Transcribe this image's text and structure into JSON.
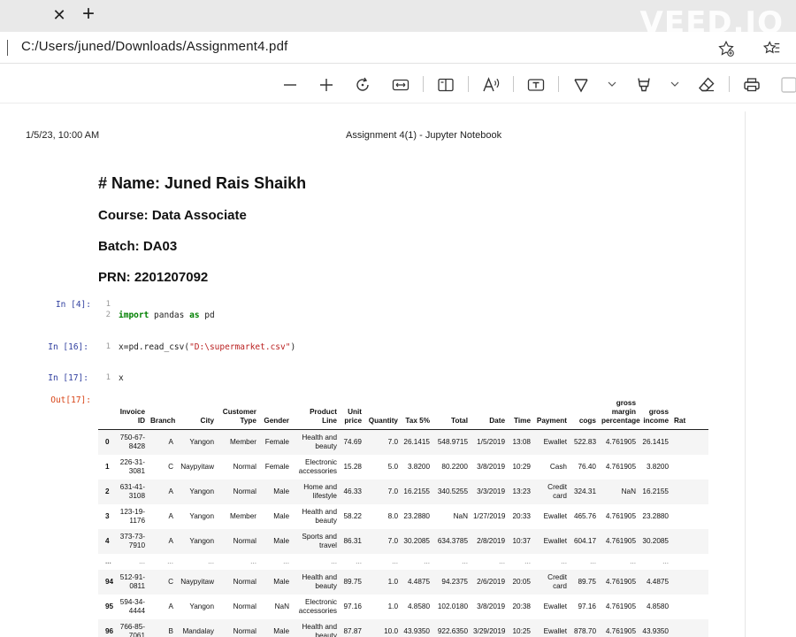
{
  "browser": {
    "close_glyph": "✕",
    "new_tab_glyph": "+",
    "watermark": "VEED.IO",
    "address": "C:/Users/juned/Downloads/Assignment4.pdf"
  },
  "toolbar": {
    "icons": [
      "zoom-out-icon",
      "zoom-in-icon",
      "rotate-icon",
      "fit-width-icon",
      "page-view-icon",
      "read-aloud-icon",
      "text-box-icon",
      "draw-icon",
      "highlight-icon",
      "eraser-icon",
      "print-icon",
      "save-icon"
    ]
  },
  "print_header": {
    "date": "1/5/23, 10:00 AM",
    "title": "Assignment 4(1) - Jupyter Notebook"
  },
  "notebook": {
    "name_heading": "# Name: Juned Rais Shaikh",
    "course": "Course: Data Associate",
    "batch": "Batch: DA03",
    "prn": "PRN: 2201207092",
    "cells": [
      {
        "prompt": "In [4]:",
        "lines": [
          "",
          "import pandas as pd"
        ]
      },
      {
        "prompt": "In [16]:",
        "lines": [
          "x=pd.read_csv(\"D:\\supermarket.csv\")"
        ]
      },
      {
        "prompt": "In [17]:",
        "lines": [
          "x"
        ]
      }
    ],
    "out_prompt": "Out[17]:"
  },
  "dataframe": {
    "columns": [
      "",
      "Invoice ID",
      "Branch",
      "City",
      "Customer Type",
      "Gender",
      "Product Line",
      "Unit price",
      "Quantity",
      "Tax 5%",
      "Total",
      "Date",
      "Time",
      "Payment",
      "cogs",
      "gross margin percentage",
      "gross income",
      "Rat"
    ],
    "rows": [
      [
        "0",
        "750-67-8428",
        "A",
        "Yangon",
        "Member",
        "Female",
        "Health and beauty",
        "74.69",
        "7.0",
        "26.1415",
        "548.9715",
        "1/5/2019",
        "13:08",
        "Ewallet",
        "522.83",
        "4.761905",
        "26.1415",
        ""
      ],
      [
        "1",
        "226-31-3081",
        "C",
        "Naypyitaw",
        "Normal",
        "Female",
        "Electronic accessories",
        "15.28",
        "5.0",
        "3.8200",
        "80.2200",
        "3/8/2019",
        "10:29",
        "Cash",
        "76.40",
        "4.761905",
        "3.8200",
        ""
      ],
      [
        "2",
        "631-41-3108",
        "A",
        "Yangon",
        "Normal",
        "Male",
        "Home and lifestyle",
        "46.33",
        "7.0",
        "16.2155",
        "340.5255",
        "3/3/2019",
        "13:23",
        "Credit card",
        "324.31",
        "NaN",
        "16.2155",
        ""
      ],
      [
        "3",
        "123-19-1176",
        "A",
        "Yangon",
        "Member",
        "Male",
        "Health and beauty",
        "58.22",
        "8.0",
        "23.2880",
        "NaN",
        "1/27/2019",
        "20:33",
        "Ewallet",
        "465.76",
        "4.761905",
        "23.2880",
        ""
      ],
      [
        "4",
        "373-73-7910",
        "A",
        "Yangon",
        "Normal",
        "Male",
        "Sports and travel",
        "86.31",
        "7.0",
        "30.2085",
        "634.3785",
        "2/8/2019",
        "10:37",
        "Ewallet",
        "604.17",
        "4.761905",
        "30.2085",
        ""
      ],
      [
        "...",
        "...",
        "...",
        "...",
        "...",
        "...",
        "...",
        "...",
        "...",
        "...",
        "...",
        "...",
        "...",
        "...",
        "...",
        "...",
        "...",
        ""
      ],
      [
        "94",
        "512-91-0811",
        "C",
        "Naypyitaw",
        "Normal",
        "Male",
        "Health and beauty",
        "89.75",
        "1.0",
        "4.4875",
        "94.2375",
        "2/6/2019",
        "20:05",
        "Credit card",
        "89.75",
        "4.761905",
        "4.4875",
        ""
      ],
      [
        "95",
        "594-34-4444",
        "A",
        "Yangon",
        "Normal",
        "NaN",
        "Electronic accessories",
        "97.16",
        "1.0",
        "4.8580",
        "102.0180",
        "3/8/2019",
        "20:38",
        "Ewallet",
        "97.16",
        "4.761905",
        "4.8580",
        ""
      ],
      [
        "96",
        "766-85-7061",
        "B",
        "Mandalay",
        "Normal",
        "Male",
        "Health and beauty",
        "87.87",
        "10.0",
        "43.9350",
        "922.6350",
        "3/29/2019",
        "10:25",
        "Ewallet",
        "878.70",
        "4.761905",
        "43.9350",
        ""
      ]
    ]
  }
}
